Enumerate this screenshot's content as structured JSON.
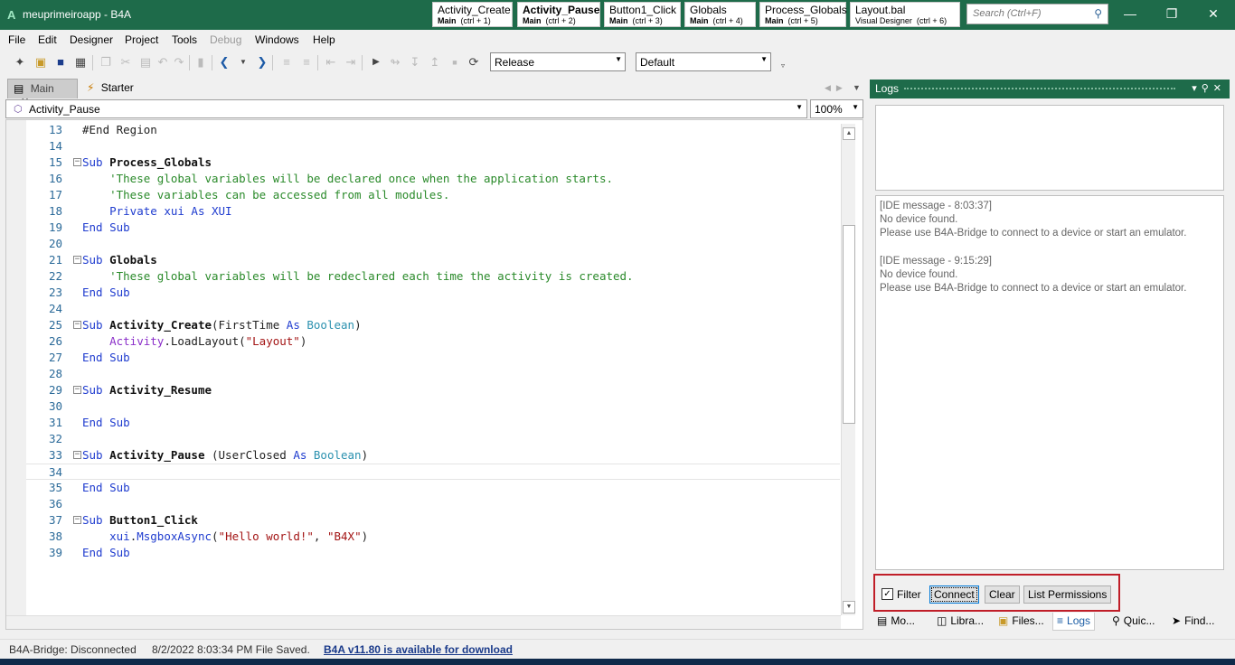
{
  "window": {
    "title": "meuprimeiroapp - B4A",
    "logo": "A",
    "minimize": "—",
    "maximize": "❐",
    "close": "✕"
  },
  "quick_tabs": [
    {
      "name": "Activity_Create",
      "module": "Main",
      "shortcut": "(ctrl + 1)"
    },
    {
      "name": "Activity_Pause",
      "module": "Main",
      "shortcut": "(ctrl + 2)"
    },
    {
      "name": "Button1_Click",
      "module": "Main",
      "shortcut": "(ctrl + 3)"
    },
    {
      "name": "Globals",
      "module": "Main",
      "shortcut": "(ctrl + 4)"
    },
    {
      "name": "Process_Globals",
      "module": "Main",
      "shortcut": "(ctrl + 5)"
    },
    {
      "name": "Layout.bal",
      "module": "Visual Designer",
      "shortcut": "(ctrl + 6)"
    }
  ],
  "search": {
    "placeholder": "Search (Ctrl+F)",
    "icon": "search-icon"
  },
  "menu": [
    "File",
    "Edit",
    "Designer",
    "Project",
    "Tools",
    "Debug",
    "Windows",
    "Help"
  ],
  "toolbar": {
    "build_config": "Release",
    "device_config": "Default"
  },
  "doc_tabs": [
    {
      "label": "Main",
      "close": "✕"
    },
    {
      "label": "Starter"
    }
  ],
  "editor": {
    "current_sub": "Activity_Pause",
    "zoom": "100%",
    "lines": [
      {
        "n": "13",
        "fold": false,
        "tokens": [
          {
            "c": "pl",
            "t": "#End Region"
          }
        ]
      },
      {
        "n": "14",
        "fold": false,
        "tokens": []
      },
      {
        "n": "15",
        "fold": true,
        "tokens": [
          {
            "c": "kw",
            "t": "Sub "
          },
          {
            "c": "nm",
            "t": "Process_Globals"
          }
        ]
      },
      {
        "n": "16",
        "fold": false,
        "tokens": [
          {
            "c": "cm",
            "t": "    'These global variables will be declared once when the application starts."
          }
        ]
      },
      {
        "n": "17",
        "fold": false,
        "tokens": [
          {
            "c": "cm",
            "t": "    'These variables can be accessed from all modules."
          }
        ]
      },
      {
        "n": "18",
        "fold": false,
        "tokens": [
          {
            "c": "kw",
            "t": "    Private "
          },
          {
            "c": "kw",
            "t": "xui "
          },
          {
            "c": "kw",
            "t": "As "
          },
          {
            "c": "kw",
            "t": "XUI"
          }
        ]
      },
      {
        "n": "19",
        "fold": false,
        "tokens": [
          {
            "c": "kw",
            "t": "End Sub"
          }
        ]
      },
      {
        "n": "20",
        "fold": false,
        "tokens": []
      },
      {
        "n": "21",
        "fold": true,
        "tokens": [
          {
            "c": "kw",
            "t": "Sub "
          },
          {
            "c": "nm",
            "t": "Globals"
          }
        ]
      },
      {
        "n": "22",
        "fold": false,
        "tokens": [
          {
            "c": "cm",
            "t": "    'These global variables will be redeclared each time the activity is created."
          }
        ]
      },
      {
        "n": "23",
        "fold": false,
        "tokens": [
          {
            "c": "kw",
            "t": "End Sub"
          }
        ]
      },
      {
        "n": "24",
        "fold": false,
        "tokens": []
      },
      {
        "n": "25",
        "fold": true,
        "tokens": [
          {
            "c": "kw",
            "t": "Sub "
          },
          {
            "c": "nm",
            "t": "Activity_Create"
          },
          {
            "c": "pl",
            "t": "(FirstTime "
          },
          {
            "c": "kw",
            "t": "As "
          },
          {
            "c": "ty",
            "t": "Boolean"
          },
          {
            "c": "pl",
            "t": ")"
          }
        ]
      },
      {
        "n": "26",
        "fold": false,
        "tokens": [
          {
            "c": "ob",
            "t": "    Activity"
          },
          {
            "c": "pl",
            "t": ".LoadLayout("
          },
          {
            "c": "st",
            "t": "\"Layout\""
          },
          {
            "c": "pl",
            "t": ")"
          }
        ]
      },
      {
        "n": "27",
        "fold": false,
        "tokens": [
          {
            "c": "kw",
            "t": "End Sub"
          }
        ]
      },
      {
        "n": "28",
        "fold": false,
        "tokens": []
      },
      {
        "n": "29",
        "fold": true,
        "tokens": [
          {
            "c": "kw",
            "t": "Sub "
          },
          {
            "c": "nm",
            "t": "Activity_Resume"
          }
        ]
      },
      {
        "n": "30",
        "fold": false,
        "tokens": []
      },
      {
        "n": "31",
        "fold": false,
        "tokens": [
          {
            "c": "kw",
            "t": "End Sub"
          }
        ]
      },
      {
        "n": "32",
        "fold": false,
        "tokens": []
      },
      {
        "n": "33",
        "fold": true,
        "tokens": [
          {
            "c": "kw",
            "t": "Sub "
          },
          {
            "c": "nm",
            "t": "Activity_Pause"
          },
          {
            "c": "pl",
            "t": " (UserClosed "
          },
          {
            "c": "kw",
            "t": "As "
          },
          {
            "c": "ty",
            "t": "Boolean"
          },
          {
            "c": "pl",
            "t": ")"
          }
        ]
      },
      {
        "n": "34",
        "fold": false,
        "current": true,
        "tokens": []
      },
      {
        "n": "35",
        "fold": false,
        "tokens": [
          {
            "c": "kw",
            "t": "End Sub"
          }
        ]
      },
      {
        "n": "36",
        "fold": false,
        "tokens": []
      },
      {
        "n": "37",
        "fold": true,
        "tokens": [
          {
            "c": "kw",
            "t": "Sub "
          },
          {
            "c": "nm",
            "t": "Button1_Click"
          }
        ]
      },
      {
        "n": "38",
        "fold": false,
        "tokens": [
          {
            "c": "kw",
            "t": "    xui"
          },
          {
            "c": "pl",
            "t": "."
          },
          {
            "c": "kw",
            "t": "MsgboxAsync"
          },
          {
            "c": "pl",
            "t": "("
          },
          {
            "c": "st",
            "t": "\"Hello world!\""
          },
          {
            "c": "pl",
            "t": ", "
          },
          {
            "c": "st",
            "t": "\"B4X\""
          },
          {
            "c": "pl",
            "t": ")"
          }
        ]
      },
      {
        "n": "39",
        "fold": false,
        "tokens": [
          {
            "c": "kw",
            "t": "End Sub"
          }
        ]
      }
    ]
  },
  "logs": {
    "title": "Logs",
    "messages": [
      {
        "header": "[IDE message - 8:03:37]",
        "line1": "No device found.",
        "line2": "Please use B4A-Bridge to connect to a device or start an emulator."
      },
      {
        "header": "[IDE message - 9:15:29]",
        "line1": "No device found.",
        "line2": "Please use B4A-Bridge to connect to a device or start an emulator."
      }
    ],
    "filter_label": "Filter",
    "filter_checked": true,
    "connect_label": "Connect",
    "clear_label": "Clear",
    "permissions_label": "List Permissions",
    "tabs": [
      "Mo...",
      "Libra...",
      "Files...",
      "Logs",
      "Quic...",
      "Find..."
    ]
  },
  "status": {
    "bridge": "B4A-Bridge: Disconnected",
    "saved": "8/2/2022 8:03:34 PM   File Saved.",
    "update": "B4A v11.80 is available for download"
  }
}
